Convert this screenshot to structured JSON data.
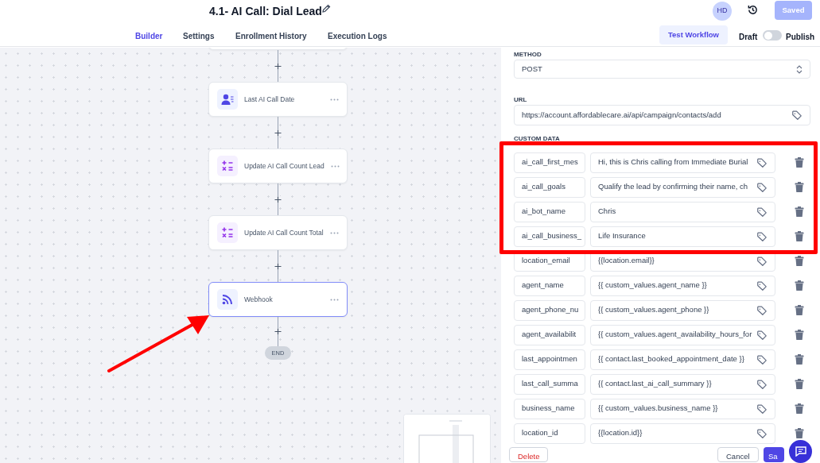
{
  "header": {
    "title": "4.1- AI Call: Dial Lead",
    "avatar": "HD",
    "save_button": {
      "label": "Saved",
      "disabled": true
    }
  },
  "tabs": [
    {
      "label": "Builder",
      "selected": true
    },
    {
      "label": "Settings",
      "selected": false
    },
    {
      "label": "Enrollment History",
      "selected": false
    },
    {
      "label": "Execution Logs",
      "selected": false
    }
  ],
  "test_button": "Test Workflow",
  "publish_toggle": {
    "off_label": "Draft",
    "on_label": "Publish",
    "on": false
  },
  "workflow": {
    "steps": [
      {
        "label": "Last AI Call Date",
        "kind": "contact",
        "selected": false
      },
      {
        "label": "Update AI Call Count Lead",
        "kind": "math",
        "selected": false
      },
      {
        "label": "Update AI Call Count Total",
        "kind": "math",
        "selected": false
      },
      {
        "label": "Webhook",
        "kind": "webhook",
        "selected": true
      }
    ],
    "end": "END"
  },
  "panel": {
    "method": {
      "label": "METHOD",
      "value": "POST"
    },
    "url": {
      "label": "URL",
      "value": "https://account.affordablecare.ai/api/campaign/contacts/add"
    },
    "custom_data": {
      "label": "CUSTOM DATA",
      "rows": [
        {
          "key": "ai_call_first_mes",
          "value": "Hi, this is Chris calling from Immediate Burial"
        },
        {
          "key": "ai_call_goals",
          "value": "Qualify the lead by confirming their name, ch"
        },
        {
          "key": "ai_bot_name",
          "value": "Chris"
        },
        {
          "key": "ai_call_business_",
          "value": "Life Insurance"
        },
        {
          "key": "location_email",
          "value": "{{location.email}}"
        },
        {
          "key": "agent_name",
          "value": "{{ custom_values.agent_name }}"
        },
        {
          "key": "agent_phone_nu",
          "value": "{{ custom_values.agent_phone }}"
        },
        {
          "key": "agent_availabilit",
          "value": "{{ custom_values.agent_availability_hours_for"
        },
        {
          "key": "last_appointmen",
          "value": "{{ contact.last_booked_appointment_date }}"
        },
        {
          "key": "last_call_summa",
          "value": "{{ contact.last_ai_call_summary }}"
        },
        {
          "key": "business_name",
          "value": "{{ custom_values.business_name }}"
        },
        {
          "key": "location_id",
          "value": "{{location.id}}"
        }
      ]
    },
    "buttons": {
      "delete": "Delete",
      "cancel": "Cancel",
      "save": "Sa"
    }
  }
}
